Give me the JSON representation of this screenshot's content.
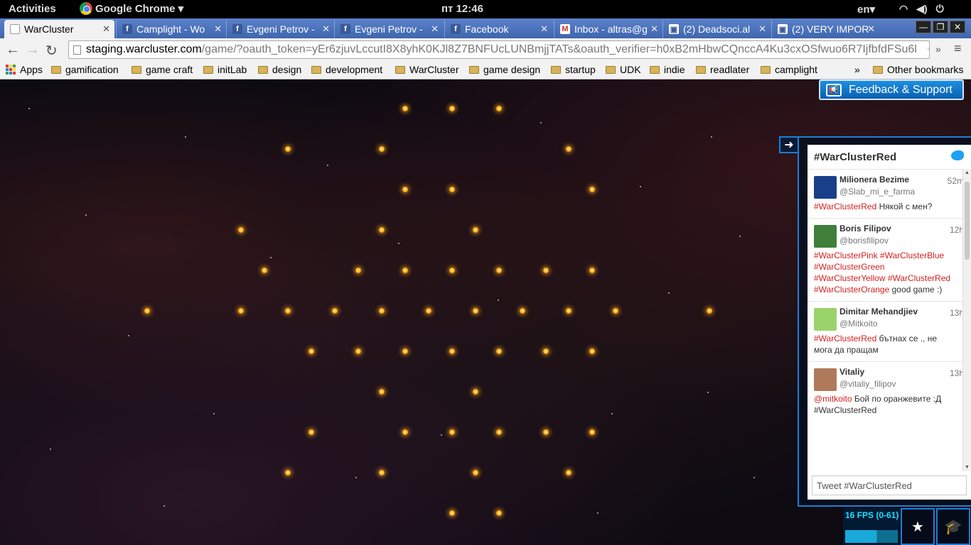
{
  "topbar": {
    "activities": "Activities",
    "app_name": "Google Chrome ▾",
    "clock": "пт 12:46",
    "lang": "en▾",
    "icons": [
      "wifi-icon",
      "volume-icon",
      "power-icon"
    ]
  },
  "tabs": [
    {
      "label": "WarCluster",
      "favicon": "doc"
    },
    {
      "label": "Camplight - Wo",
      "favicon": "facebook"
    },
    {
      "label": "Evgeni Petrov -",
      "favicon": "facebook"
    },
    {
      "label": "Evgeni Petrov -",
      "favicon": "facebook"
    },
    {
      "label": "Facebook",
      "favicon": "facebook"
    },
    {
      "label": "Inbox - altras@g",
      "favicon": "gmail"
    },
    {
      "label": "(2) Deadsoci.al",
      "favicon": "deadsocial"
    },
    {
      "label": "(2) VERY IMPOR",
      "favicon": "deadsocial"
    }
  ],
  "toolbar": {
    "url_host": "staging.warcluster.com",
    "url_rest": "/game/?oauth_token=yEr6zjuvLccutI8X8yhK0KJl8Z7BNFUcLUNBmjjTATs&oauth_verifier=h0xB2mHbwCQnccA4Ku3cxOSfwuo6R7IjfbfdFSu6l"
  },
  "bookmarks": {
    "apps": "Apps",
    "items": [
      "gamification",
      "game craft",
      "initLab",
      "design",
      "development",
      "WarCluster",
      "game design",
      "startup",
      "UDK",
      "indie",
      "readlater",
      "camplight"
    ],
    "overflow": "»",
    "other": "Other bookmarks"
  },
  "game": {
    "feedback_label": "Feedback & Support",
    "planet_color": "#ffb928",
    "fps_label": "16 FPS (0-61)"
  },
  "twitter": {
    "hashtag": "#WarClusterRed",
    "input_placeholder": "Tweet #WarClusterRed",
    "tweets": [
      {
        "name": "Milionera Bezime",
        "handle": "@Slab_mi_e_farma",
        "time": "52m",
        "tags": "#WarClusterRed",
        "text": " Някой с мен?",
        "avatar_color": "#1a3f8a"
      },
      {
        "name": "Boris Filipov",
        "handle": "@borisfilipov",
        "time": "12h",
        "tags": "#WarClusterPink  #WarClusterBlue #WarClusterGreen  #WarClusterYellow  #WarClusterRed  #WarClusterOrange",
        "text": " good game :)",
        "avatar_color": "#3f7f3a"
      },
      {
        "name": "Dimitar Mehandjiev",
        "handle": "@Mitkoito",
        "time": "13h",
        "tags": "#WarClusterRed",
        "text": " бътнах се ., не мога да пращам",
        "avatar_color": "#9bd36b"
      },
      {
        "name": "Vitaliy",
        "handle": "@vitaliy_filipov",
        "time": "13h",
        "tags": "@mitkoito",
        "text": " Бой по оранжевите :Д #WarClusterRed",
        "avatar_color": "#b07a5a"
      }
    ]
  }
}
